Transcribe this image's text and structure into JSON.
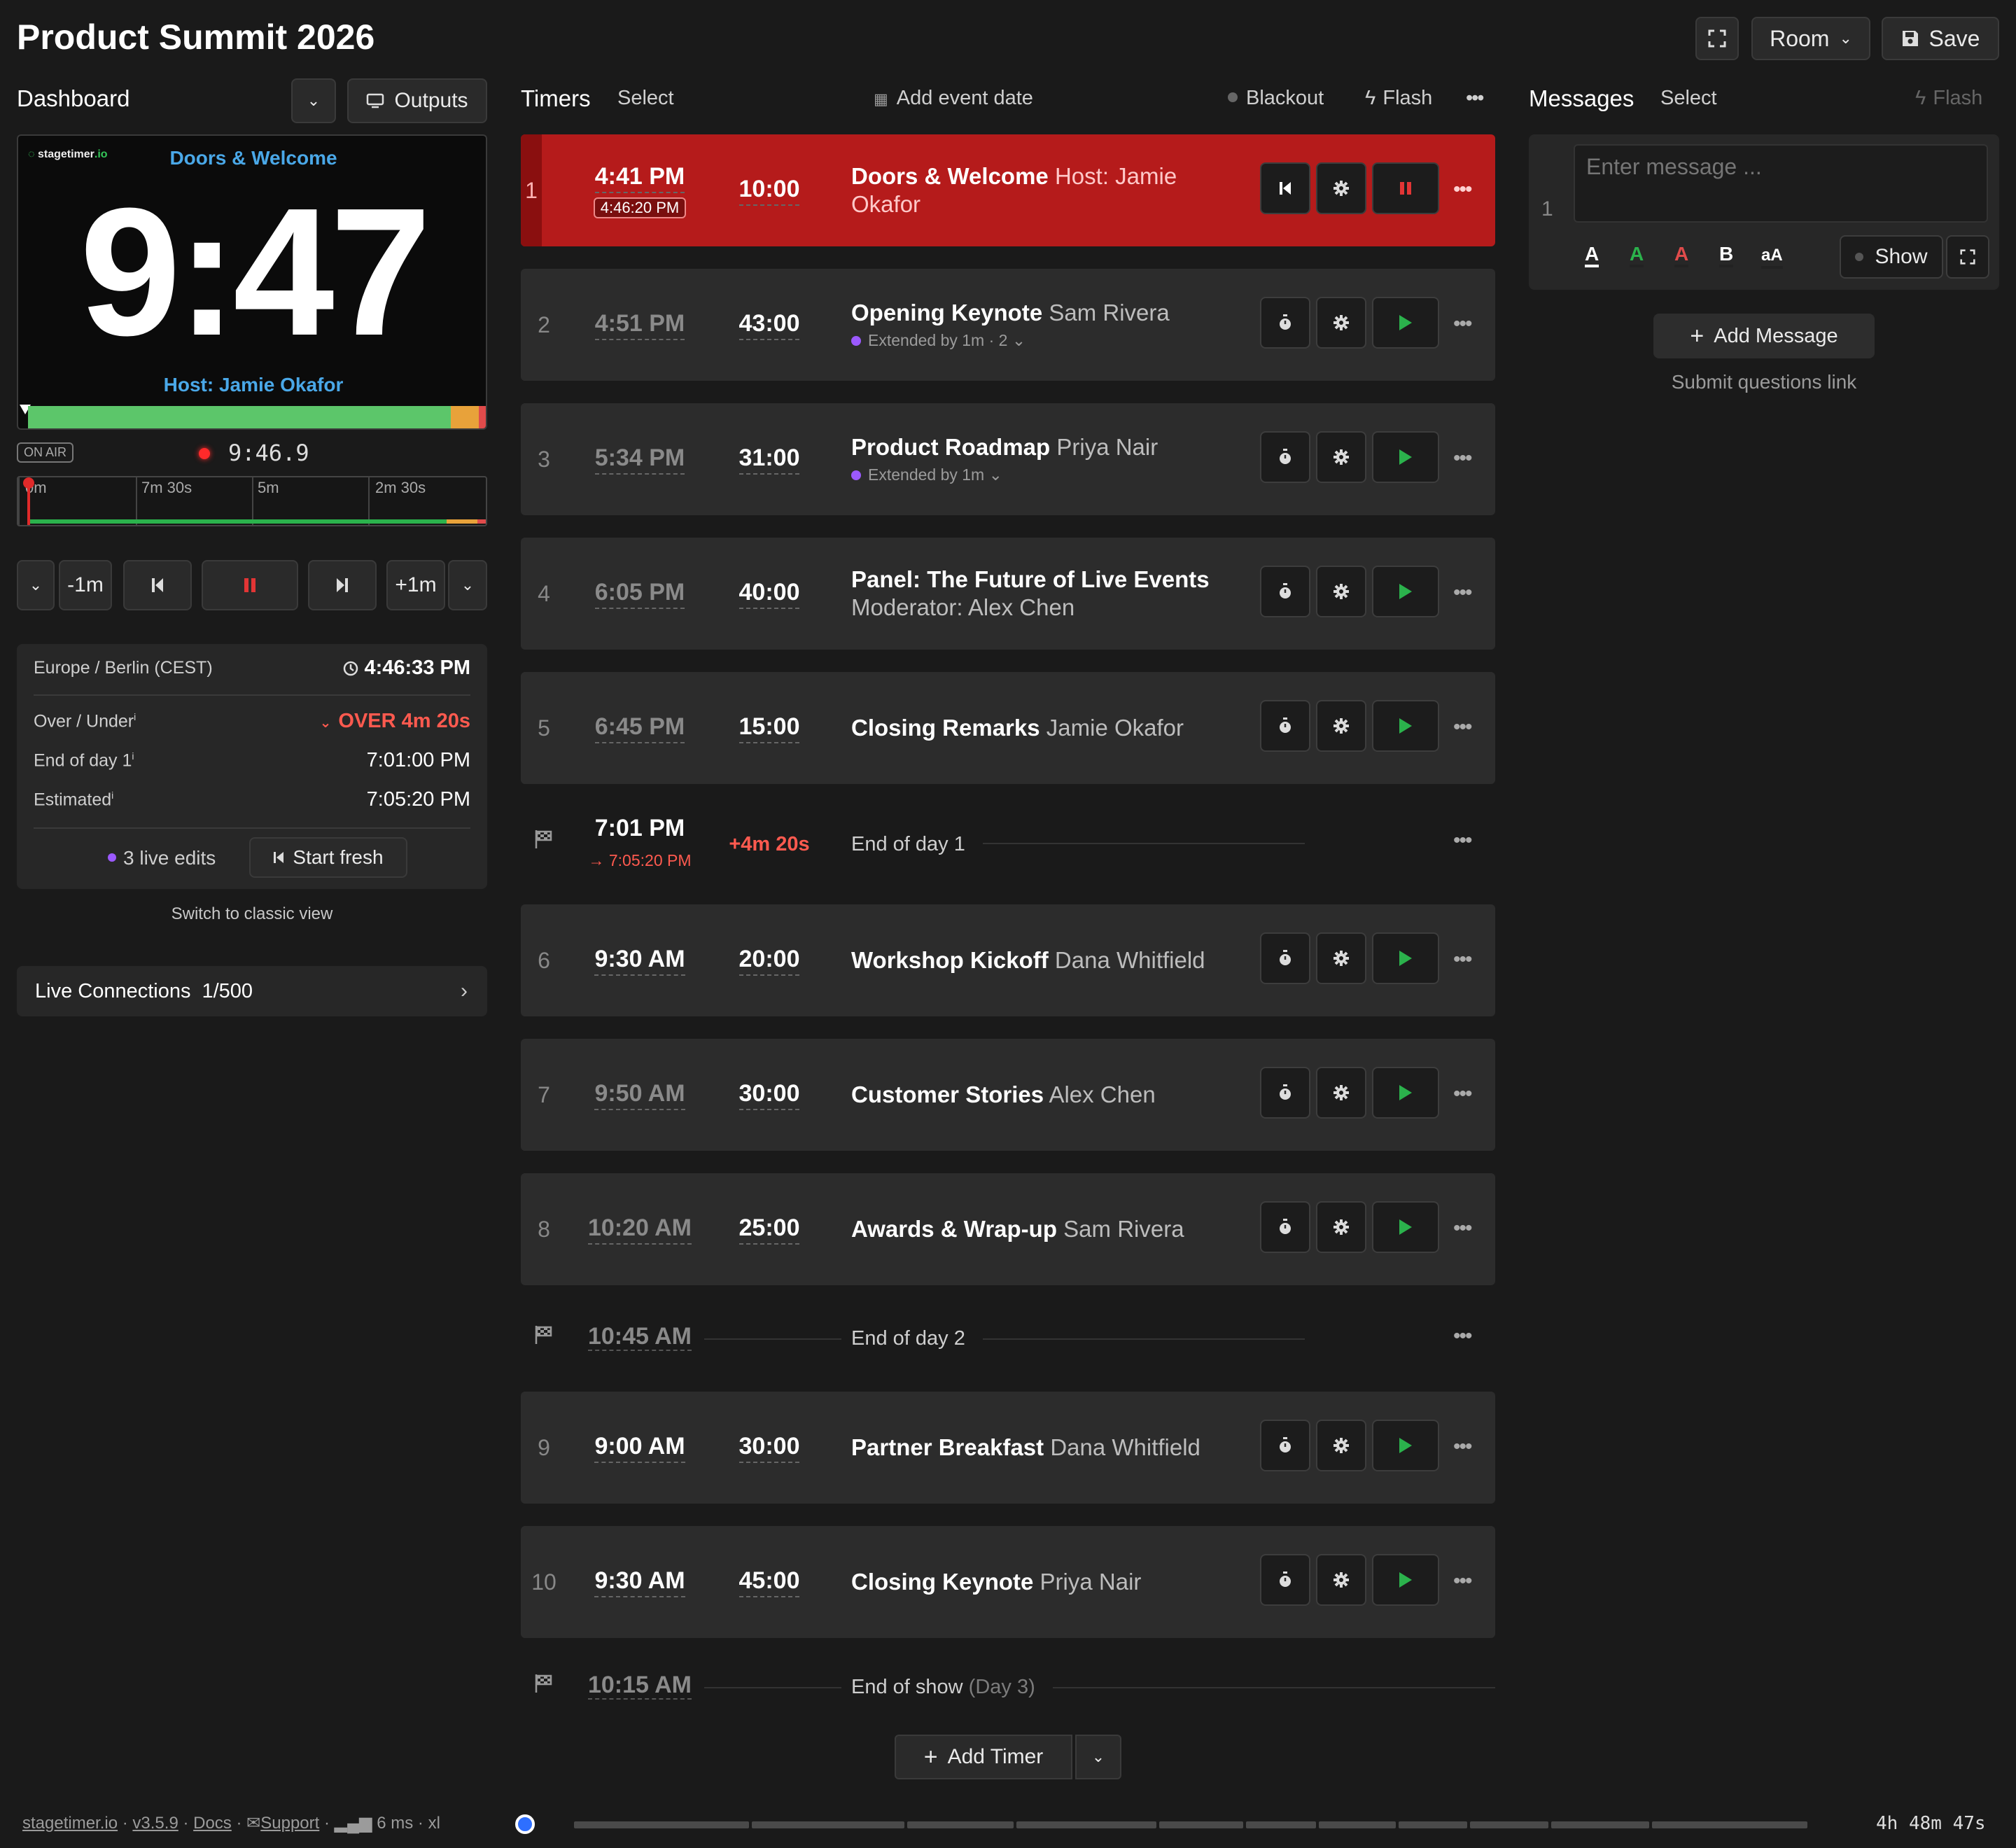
{
  "header": {
    "title": "Product Summit 2026",
    "room_label": "Room",
    "save_label": "Save"
  },
  "dashboard": {
    "title": "Dashboard",
    "outputs_label": "Outputs",
    "preview": {
      "logo": "stagetimer",
      "logo_suffix": ".io",
      "title": "Doors & Welcome",
      "time": "9:47",
      "host": "Host: Jamie Okafor"
    },
    "on_air": "ON AIR",
    "recorded_time": "9:46.9",
    "timeline_ticks": [
      "0m",
      "7m 30s",
      "5m",
      "2m 30s"
    ],
    "controls": {
      "minus": "-1m",
      "plus": "+1m"
    },
    "info": {
      "timezone": "Europe / Berlin (CEST)",
      "clock": "4:46:33 PM",
      "over_under_label": "Over / Under",
      "over_under_value": "OVER 4m 20s",
      "end_of_day_label": "End of day 1",
      "end_of_day_value": "7:01:00 PM",
      "estimated_label": "Estimated",
      "estimated_value": "7:05:20 PM",
      "live_edits": "3 live edits",
      "start_fresh": "Start fresh"
    },
    "switch_view": "Switch to classic view",
    "live_connections": "Live Connections",
    "live_connections_count": "1/500"
  },
  "timers": {
    "title": "Timers",
    "select": "Select",
    "add_event_date": "Add event date",
    "blackout": "Blackout",
    "flash": "Flash",
    "rows": [
      {
        "num": "1",
        "start": "4:41 PM",
        "actual": "4:46:20 PM",
        "duration": "10:00",
        "title": "Doors & Welcome",
        "speaker": "Host: Jamie Okafor",
        "ext": ""
      },
      {
        "num": "2",
        "start": "4:51 PM",
        "duration": "43:00",
        "title": "Opening Keynote",
        "speaker": "Sam Rivera",
        "ext": "Extended by 1m · 2"
      },
      {
        "num": "3",
        "start": "5:34 PM",
        "duration": "31:00",
        "title": "Product Roadmap",
        "speaker": "Priya Nair",
        "ext": "Extended by 1m"
      },
      {
        "num": "4",
        "start": "6:05 PM",
        "duration": "40:00",
        "title": "Panel: The Future of Live Events",
        "speaker": "Moderator: Alex Chen",
        "ext": ""
      },
      {
        "num": "5",
        "start": "6:45 PM",
        "duration": "15:00",
        "title": "Closing Remarks",
        "speaker": "Jamie Okafor",
        "ext": ""
      },
      {
        "num": "6",
        "start": "9:30 AM",
        "duration": "20:00",
        "title": "Workshop Kickoff",
        "speaker": "Dana Whitfield",
        "ext": ""
      },
      {
        "num": "7",
        "start": "9:50 AM",
        "duration": "30:00",
        "title": "Customer Stories",
        "speaker": "Alex Chen",
        "ext": ""
      },
      {
        "num": "8",
        "start": "10:20 AM",
        "duration": "25:00",
        "title": "Awards & Wrap-up",
        "speaker": "Sam Rivera",
        "ext": ""
      },
      {
        "num": "9",
        "start": "9:00 AM",
        "duration": "30:00",
        "title": "Partner Breakfast",
        "speaker": "Dana Whitfield",
        "ext": ""
      },
      {
        "num": "10",
        "start": "9:30 AM",
        "duration": "45:00",
        "title": "Closing Keynote",
        "speaker": "Priya Nair",
        "ext": ""
      }
    ],
    "day_ends": [
      {
        "time": "7:01 PM",
        "projected": "→ 7:05:20 PM",
        "delta": "+4m 20s",
        "label": "End of day 1"
      },
      {
        "time": "10:45 AM",
        "label": "End of day 2"
      },
      {
        "time": "10:15 AM",
        "label": "End of show",
        "sub": "(Day 3)"
      }
    ],
    "add_timer": "Add Timer"
  },
  "messages": {
    "title": "Messages",
    "select": "Select",
    "flash": "Flash",
    "placeholder": "Enter message ...",
    "msg_num": "1",
    "show": "Show",
    "add_message": "Add Message",
    "submit_link": "Submit questions link"
  },
  "footer": {
    "site": "stagetimer.io",
    "version": "v3.5.9",
    "docs": "Docs",
    "support": "Support",
    "latency": "6 ms",
    "size": "xl",
    "total": "4h 48m 47s"
  },
  "colors": {
    "active_row": "#b51b1b",
    "play_green": "#2bb24c",
    "accent_blue": "#4aa8e8",
    "over_red": "#ff5a4f"
  }
}
